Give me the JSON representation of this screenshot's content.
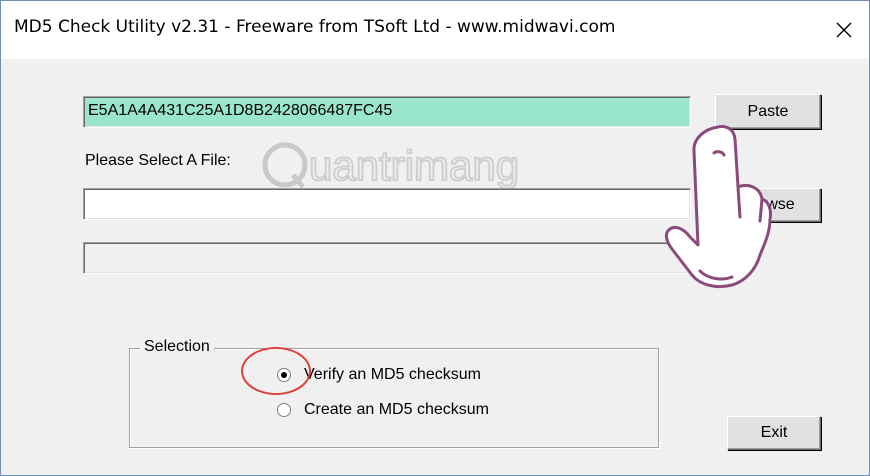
{
  "window": {
    "title": "MD5 Check Utility v2.31 - Freeware from TSoft Ltd - www.midwavi.com"
  },
  "hash_field": {
    "value": "E5A1A4A431C25A1D8B2428066487FC45"
  },
  "file": {
    "label": "Please Select A File:",
    "value": ""
  },
  "progress": {
    "value": 0
  },
  "buttons": {
    "paste_label": "Paste",
    "browse_label": "Browse",
    "exit_label": "Exit"
  },
  "selection": {
    "legend": "Selection",
    "options": [
      {
        "label": "Verify an MD5 checksum",
        "selected": true
      },
      {
        "label": "Create an MD5 checksum",
        "selected": false
      }
    ]
  },
  "watermark": {
    "text": "Quantrimang"
  },
  "colors": {
    "hash_field_bg": "#99e6cc",
    "highlight_ring": "#e0403a",
    "hand_outline": "#8a4a7a"
  },
  "icons": {
    "close": "close-icon",
    "hand": "pointing-hand-icon"
  }
}
